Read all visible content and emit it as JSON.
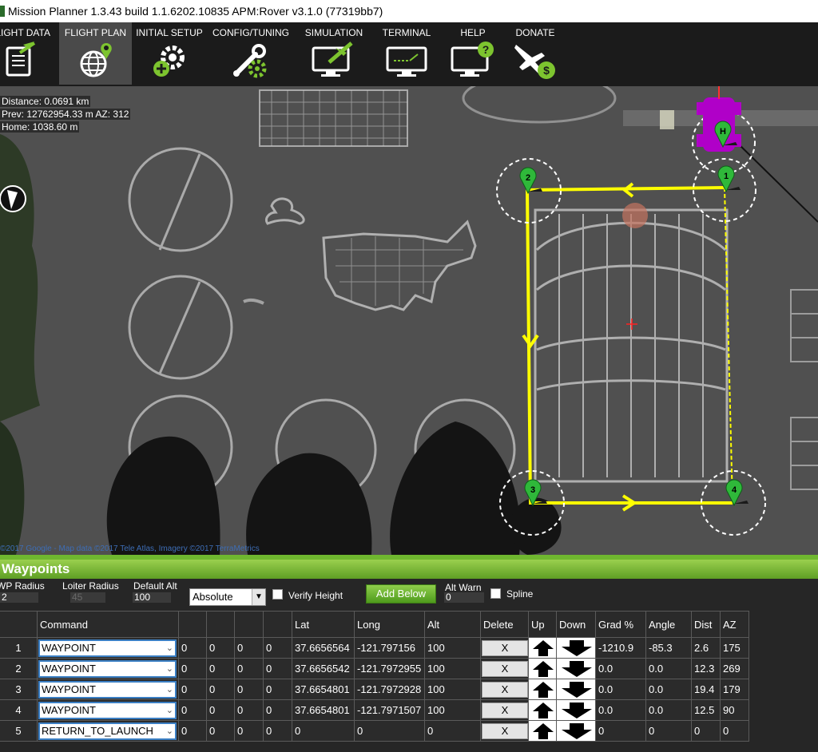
{
  "window": {
    "title": "Mission Planner 1.3.43 build 1.1.6202.10835 APM:Rover v3.1.0 (77319bb7)"
  },
  "menu": {
    "items": [
      {
        "label": "FLIGHT DATA",
        "icon": "flight-data-icon"
      },
      {
        "label": "FLIGHT PLAN",
        "icon": "flight-plan-globe-icon"
      },
      {
        "label": "INITIAL SETUP",
        "icon": "initial-setup-gear-icon"
      },
      {
        "label": "CONFIG/TUNING",
        "icon": "config-tuning-wrench-icon"
      },
      {
        "label": "SIMULATION",
        "icon": "simulation-monitor-icon"
      },
      {
        "label": "TERMINAL",
        "icon": "terminal-monitor-icon"
      },
      {
        "label": "HELP",
        "icon": "help-monitor-icon"
      },
      {
        "label": "DONATE",
        "icon": "donate-plane-icon"
      }
    ],
    "active": "FLIGHT PLAN"
  },
  "map": {
    "distance": "Distance: 0.0691 km",
    "prev": "Prev: 12762954.33 m AZ: 312",
    "home": "Home: 1038.60 m",
    "attribution": "©2017 Google - Map data ©2017 Tele Atlas, Imagery ©2017 TerraMetrics",
    "markers": [
      "H",
      "1",
      "2",
      "3",
      "4"
    ],
    "route_color": "#ffff00",
    "marker_color": "#2fb83a"
  },
  "waypoints": {
    "title": "Waypoints",
    "wp_radius_label": "WP Radius",
    "wp_radius": "2",
    "loiter_radius_label": "Loiter Radius",
    "loiter_radius": "45",
    "default_alt_label": "Default Alt",
    "default_alt": "100",
    "alt_mode": "Absolute",
    "verify_height_label": "Verify Height",
    "add_below_label": "Add Below",
    "alt_warn_label": "Alt Warn",
    "alt_warn": "0",
    "spline_label": "Spline"
  },
  "table": {
    "headers": [
      "",
      "Command",
      "",
      "",
      "",
      "",
      "Lat",
      "Long",
      "Alt",
      "Delete",
      "Up",
      "Down",
      "Grad %",
      "Angle",
      "Dist",
      "AZ"
    ],
    "rows": [
      {
        "num": "1",
        "command": "WAYPOINT",
        "p1": "0",
        "p2": "0",
        "p3": "0",
        "p4": "0",
        "lat": "37.6656564",
        "long": "-121.797156",
        "alt": "100",
        "delete": "X",
        "grad": "-1210.9",
        "angle": "-85.3",
        "dist": "2.6",
        "az": "175"
      },
      {
        "num": "2",
        "command": "WAYPOINT",
        "p1": "0",
        "p2": "0",
        "p3": "0",
        "p4": "0",
        "lat": "37.6656542",
        "long": "-121.7972955",
        "alt": "100",
        "delete": "X",
        "grad": "0.0",
        "angle": "0.0",
        "dist": "12.3",
        "az": "269"
      },
      {
        "num": "3",
        "command": "WAYPOINT",
        "p1": "0",
        "p2": "0",
        "p3": "0",
        "p4": "0",
        "lat": "37.6654801",
        "long": "-121.7972928",
        "alt": "100",
        "delete": "X",
        "grad": "0.0",
        "angle": "0.0",
        "dist": "19.4",
        "az": "179"
      },
      {
        "num": "4",
        "command": "WAYPOINT",
        "p1": "0",
        "p2": "0",
        "p3": "0",
        "p4": "0",
        "lat": "37.6654801",
        "long": "-121.7971507",
        "alt": "100",
        "delete": "X",
        "grad": "0.0",
        "angle": "0.0",
        "dist": "12.5",
        "az": "90"
      },
      {
        "num": "5",
        "command": "RETURN_TO_LAUNCH",
        "p1": "0",
        "p2": "0",
        "p3": "0",
        "p4": "0",
        "lat": "0",
        "long": "0",
        "alt": "0",
        "delete": "X",
        "grad": "0",
        "angle": "0",
        "dist": "0",
        "az": "0"
      }
    ]
  }
}
